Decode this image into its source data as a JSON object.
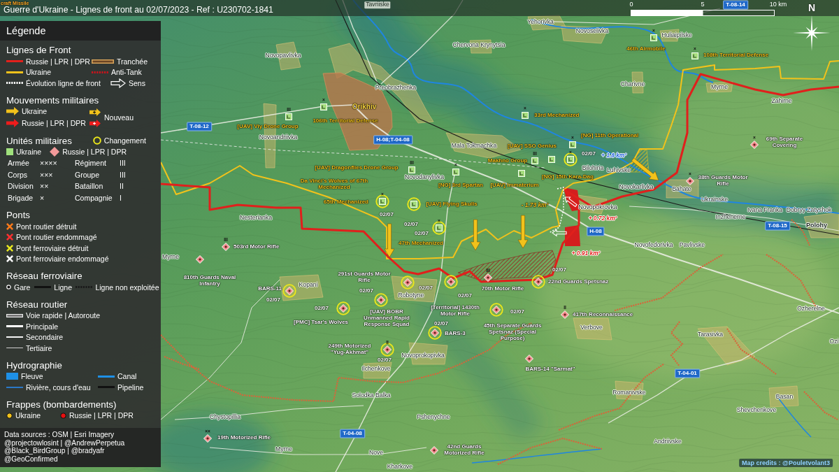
{
  "title_bar": {
    "title": "Guerre d'Ukraine - Lignes de front au 02/07/2023 - Ref : U230702-1841",
    "scale": [
      "0",
      "5",
      "10 km"
    ],
    "compass": "N"
  },
  "legend": {
    "title": "Légende",
    "sections": [
      {
        "title": "Lignes de Front",
        "items": [
          {
            "kind": "line",
            "color": "#e3201b",
            "label": "Russie | LPR | DPR"
          },
          {
            "kind": "double",
            "color": "#d8a45a",
            "label": "Tranchée"
          },
          {
            "kind": "line",
            "color": "#f2c21b",
            "label": "Ukraine"
          },
          {
            "kind": "dots",
            "color": "#c8141c",
            "label": "Anti-Tank"
          },
          {
            "kind": "dots",
            "color": "#ffffff",
            "label": "Évolution ligne de front"
          },
          {
            "kind": "hollowarrow",
            "label": "Sens"
          }
        ]
      },
      {
        "title": "Mouvements militaires",
        "items": [
          {
            "kind": "arrow",
            "color": "#f2c21b",
            "label": "Ukraine"
          },
          {
            "kind": "arrow",
            "color": "#ee1c1c",
            "label": "Russie | LPR | DPR"
          },
          {
            "kind": "newarrows",
            "label": "Nouveau"
          }
        ]
      },
      {
        "title": "Unités militaires",
        "aside": {
          "kind": "ring",
          "color": "#ece81a",
          "label": "Changement"
        },
        "items": [
          {
            "kind": "square",
            "color": "#9fe07c",
            "label": "Ukraine"
          },
          {
            "kind": "diamond",
            "color": "#f39a9a",
            "label": "Russie | LPR | DPR"
          }
        ],
        "echelons": [
          {
            "name": "Armée",
            "symbol": "××××"
          },
          {
            "name": "Régiment",
            "symbol": "III"
          },
          {
            "name": "Corps",
            "symbol": "×××"
          },
          {
            "name": "Groupe",
            "symbol": "III"
          },
          {
            "name": "Division",
            "symbol": "××"
          },
          {
            "name": "Bataillon",
            "symbol": "II"
          },
          {
            "name": "Brigade",
            "symbol": "×"
          },
          {
            "name": "Compagnie",
            "symbol": "I"
          }
        ]
      },
      {
        "title": "Ponts",
        "items": [
          {
            "kind": "cross",
            "color": "#ff7a1a",
            "label": "Pont routier détruit"
          },
          {
            "kind": "cross",
            "color": "#ff3030",
            "label": "Pont routier endommagé"
          },
          {
            "kind": "cross",
            "color": "#e8e820",
            "label": "Pont ferroviaire détruit"
          },
          {
            "kind": "cross",
            "color": "#ffffff",
            "label": "Pont ferroviaire endommagé"
          }
        ]
      },
      {
        "title": "Réseau ferroviaire",
        "items": [
          {
            "kind": "station",
            "label": "Gare"
          },
          {
            "kind": "line",
            "color": "#111111",
            "label": "Ligne"
          },
          {
            "kind": "dots",
            "color": "#1a1a1a",
            "label": "Ligne non exploitée"
          }
        ]
      },
      {
        "title": "Réseau routier",
        "items": [
          {
            "kind": "motorway",
            "label": "Voie rapide | Autoroute"
          },
          {
            "kind": "primary",
            "label": "Principale"
          },
          {
            "kind": "secondary",
            "label": "Secondaire"
          },
          {
            "kind": "tertiary",
            "label": "Tertiaire"
          }
        ]
      },
      {
        "title": "Hydrographie",
        "items": [
          {
            "kind": "swatch",
            "color": "#1e90e6",
            "label": "Fleuve"
          },
          {
            "kind": "line",
            "color": "#1e90e6",
            "label": "Canal"
          },
          {
            "kind": "thin",
            "color": "#2a78c8",
            "label": "Rivière, cours d'eau"
          },
          {
            "kind": "line",
            "color": "#111111",
            "label": "Pipeline"
          }
        ]
      },
      {
        "title": "Frappes (bombardements)",
        "items": [
          {
            "kind": "dot",
            "color": "#f2c21b",
            "label": "Ukraine"
          },
          {
            "kind": "dot",
            "color": "#e81010",
            "label": "Russie | LPR | DPR"
          }
        ]
      }
    ],
    "sources": [
      "Data sources : OSM | Esri Imagery",
      "@projectowlosint | @AndrewPerpetua",
      "@Black_BirdGroup | @bradyafr",
      "@GeoConfirmed"
    ]
  },
  "map": {
    "edge_labels": [
      "craft Missile"
    ],
    "places": [
      {
        "name": "Tavriiske",
        "kind": "regular"
      },
      {
        "name": "Yehorivka",
        "kind": "regular"
      },
      {
        "name": "Novoselivka",
        "kind": "regular"
      },
      {
        "name": "Huliaipilske",
        "kind": "regular"
      },
      {
        "name": "Chervona Krynytsia",
        "kind": "regular"
      },
      {
        "name": "Novopavlivka",
        "kind": "regular"
      },
      {
        "name": "Preobrazhenka",
        "kind": "regular"
      },
      {
        "name": "Charivne",
        "kind": "regular"
      },
      {
        "name": "Myrne",
        "kind": "regular"
      },
      {
        "name": "Orikhiv",
        "kind": "highlight"
      },
      {
        "name": "Zahirne",
        "kind": "regular"
      },
      {
        "name": "Novoandriivka",
        "kind": "regular"
      },
      {
        "name": "Mala Tokmachka",
        "kind": "regular"
      },
      {
        "name": "Bilohiria",
        "kind": "regular"
      },
      {
        "name": "Luhivske",
        "kind": "regular"
      },
      {
        "name": "Novodanylivka",
        "kind": "regular"
      },
      {
        "name": "Novokarlivka",
        "kind": "regular"
      },
      {
        "name": "Bahate",
        "kind": "regular"
      },
      {
        "name": "Ukrainske",
        "kind": "regular"
      },
      {
        "name": "Novopokrovka",
        "kind": "regular"
      },
      {
        "name": "Ivana Franka",
        "kind": "regular"
      },
      {
        "name": "Dobryy Zatyshok",
        "kind": "regular"
      },
      {
        "name": "Nesterianka",
        "kind": "regular"
      },
      {
        "name": "Inzhenerne",
        "kind": "regular"
      },
      {
        "name": "Polohy",
        "kind": "bold"
      },
      {
        "name": "Novofedorivka",
        "kind": "regular"
      },
      {
        "name": "Pavlivske",
        "kind": "regular"
      },
      {
        "name": "Myrne",
        "kind": "regular"
      },
      {
        "name": "Kopani",
        "kind": "regular"
      },
      {
        "name": "Robotyne",
        "kind": "regular"
      },
      {
        "name": "Ozherelne",
        "kind": "regular"
      },
      {
        "name": "Verbove",
        "kind": "regular"
      },
      {
        "name": "Tarasivka",
        "kind": "regular"
      },
      {
        "name": "Ozi",
        "kind": "regular"
      },
      {
        "name": "Novoprokopivka",
        "kind": "regular"
      },
      {
        "name": "Ilchenkove",
        "kind": "regular"
      },
      {
        "name": "Solodka Balka",
        "kind": "regular"
      },
      {
        "name": "Romanivske",
        "kind": "regular"
      },
      {
        "name": "Basan",
        "kind": "regular"
      },
      {
        "name": "Shevchenkove",
        "kind": "regular"
      },
      {
        "name": "Chystopillia",
        "kind": "regular"
      },
      {
        "name": "Pshenychne",
        "kind": "regular"
      },
      {
        "name": "Andriivske",
        "kind": "regular"
      },
      {
        "name": "Myrne",
        "kind": "regular"
      },
      {
        "name": "Nove",
        "kind": "regular"
      },
      {
        "name": "Kharkove",
        "kind": "regular"
      }
    ],
    "route_signs": [
      "T-08-14",
      "T-08-12",
      "H-08;T-04-08",
      "H-08",
      "T-08-15",
      "T-04-01",
      "T-04-08"
    ],
    "units": [
      {
        "kind": "ukraine",
        "label": "46th Airmobile",
        "echelon": "×",
        "changed": false
      },
      {
        "kind": "ukraine",
        "label": "108th Territorial Defense",
        "echelon": "×",
        "changed": false
      },
      {
        "kind": "ukraine",
        "label": "[UAV] Viy Drone Group",
        "echelon": "III",
        "changed": false
      },
      {
        "kind": "ukraine",
        "label": "106th Territorial Defense",
        "echelon": "×",
        "changed": false
      },
      {
        "kind": "ukraine",
        "label": "33rd Mechanized",
        "echelon": "×",
        "changed": false
      },
      {
        "kind": "ukraine",
        "label": "[NG] 11th Operational",
        "echelon": "×",
        "changed": false
      },
      {
        "kind": "russia",
        "label": "69th Separate Covering",
        "echelon": "×",
        "changed": false
      },
      {
        "kind": "ukraine",
        "label": "[UAV] Dragonflies Drone Group",
        "echelon": "III",
        "changed": false
      },
      {
        "kind": "ukraine",
        "label": "Makhno Group",
        "echelon": "III",
        "changed": false
      },
      {
        "kind": "ukraine",
        "label": "[UAV] SSO Genius",
        "changed": false
      },
      {
        "kind": "ukraine",
        "label": "Da Vinci's Wolves of 67th Mechanized",
        "changed": false
      },
      {
        "kind": "ukraine",
        "label": "[NG] 3rd Spartan",
        "echelon": "×",
        "changed": false
      },
      {
        "kind": "ukraine",
        "label": "[UAV] Immaterium",
        "changed": false
      },
      {
        "kind": "ukraine",
        "label": "[NG] 15th Kara-Dag",
        "echelon": "×",
        "changed": true,
        "date": "02/07"
      },
      {
        "kind": "russia",
        "label": "38th Guards Motor Rifle",
        "echelon": "×",
        "changed": false
      },
      {
        "kind": "ukraine",
        "label": "65th Mechanized",
        "echelon": "×",
        "changed": true,
        "date": "02/07"
      },
      {
        "kind": "ukraine",
        "label": "47th Mechanized",
        "echelon": "×",
        "changed": true,
        "date": "02/07"
      },
      {
        "kind": "ukraine",
        "label": "[UAV] Flying Skulls",
        "changed": true,
        "date": "02/07"
      },
      {
        "kind": "russia",
        "label": "503rd Motor Rifle",
        "echelon": "III",
        "changed": false
      },
      {
        "kind": "russia",
        "label": "810th Guards Naval Infantry",
        "changed": false
      },
      {
        "kind": "russia",
        "label": "BARS-11",
        "changed": true,
        "date": "02/07"
      },
      {
        "kind": "russia",
        "label": "291st Guards Motor Rifle",
        "changed": true,
        "date": "02/07"
      },
      {
        "kind": "russia",
        "label": "[Territorial] 1430th Motor Rifle",
        "changed": true,
        "date": "02/07"
      },
      {
        "kind": "russia",
        "label": "70th Motor Rifle",
        "echelon": "III",
        "changed": false
      },
      {
        "kind": "russia",
        "label": "22nd Guards Spetsnaz",
        "changed": true,
        "date": "02/07"
      },
      {
        "kind": "russia",
        "label": "[PMC] Tsar's Wolves",
        "changed": true,
        "date": "02/07"
      },
      {
        "kind": "russia",
        "label": "[UAV] BOBR Unmanned Rapid Response Squad",
        "changed": true,
        "date": "02/07"
      },
      {
        "kind": "russia",
        "label": "45th Separate Guards Spetsnaz (Special Purpose)",
        "changed": true,
        "date": "02/07"
      },
      {
        "kind": "russia",
        "label": "417th Reconnaissance",
        "echelon": "II",
        "changed": false
      },
      {
        "kind": "russia",
        "label": "BARS-3",
        "changed": true,
        "date": "02/07"
      },
      {
        "kind": "russia",
        "label": "249th Motorized \"Yug-Akhmat\"",
        "echelon": "II",
        "changed": true,
        "date": "02/07"
      },
      {
        "kind": "russia",
        "label": "BARS-14 \"Sarmat\"",
        "changed": false
      },
      {
        "kind": "russia",
        "label": "19th Motorized Rifle",
        "echelon": "××",
        "changed": false
      },
      {
        "kind": "russia",
        "label": "42nd Guards Motorized Rifle",
        "changed": false
      }
    ],
    "area_changes": [
      {
        "text": "+ 1.8 km²",
        "color": "#1f5fd8"
      },
      {
        "text": "- 1.73 km²",
        "color": "#f2c21b"
      },
      {
        "text": "+ 0.72 km²",
        "color": "#e3201b"
      },
      {
        "text": "+ 0.91 km²",
        "color": "#e3201b"
      }
    ],
    "credits": "Map credits : @Pouletvolant3"
  }
}
